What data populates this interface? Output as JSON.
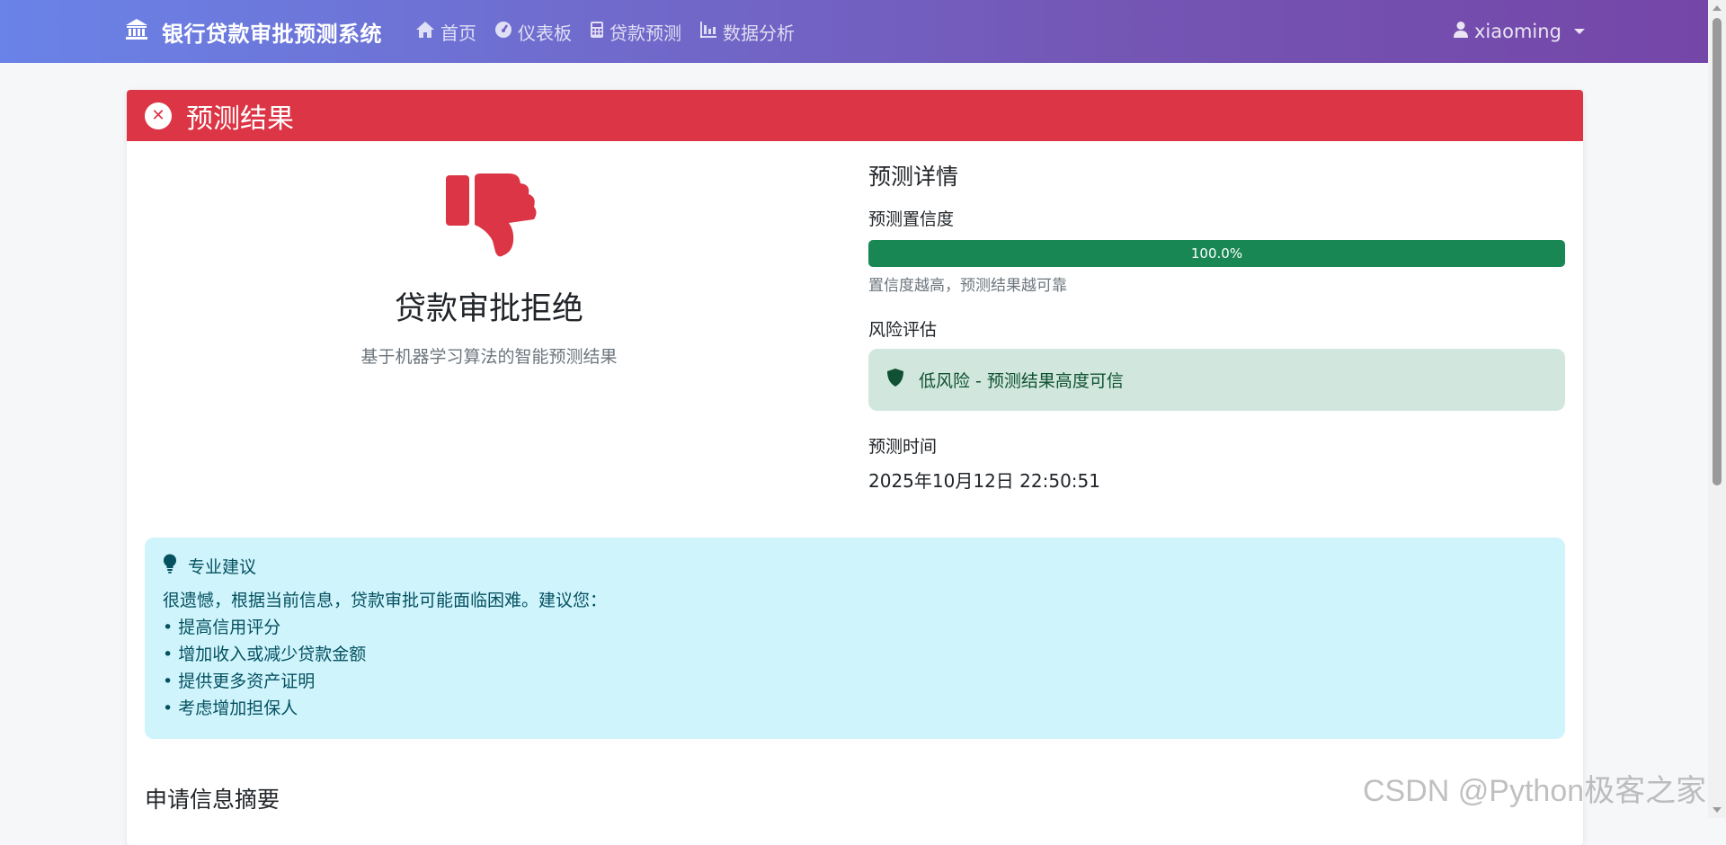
{
  "nav": {
    "brand": "银行贷款审批预测系统",
    "links": [
      "首页",
      "仪表板",
      "贷款预测",
      "数据分析"
    ],
    "user": "xiaoming"
  },
  "result": {
    "header_title": "预测结果",
    "decision": "贷款审批拒绝",
    "subtitle": "基于机器学习算法的智能预测结果"
  },
  "details": {
    "section_title": "预测详情",
    "confidence_label": "预测置信度",
    "confidence_value": "100.0%",
    "confidence_fraction": 1.0,
    "confidence_hint": "置信度越高，预测结果越可靠",
    "risk_label": "风险评估",
    "risk_text": "低风险 - 预测结果高度可信",
    "time_label": "预测时间",
    "time_value": "2025年10月12日 22:50:51"
  },
  "advice": {
    "title": "专业建议",
    "intro": "很遗憾，根据当前信息，贷款审批可能面临困难。建议您：",
    "items": [
      "• 提高信用评分",
      "• 增加收入或减少贷款金额",
      "• 提供更多资产证明",
      "• 考虑增加担保人"
    ]
  },
  "summary": {
    "title": "申请信息摘要"
  },
  "watermark": "CSDN @Python极客之家",
  "colors": {
    "header_red": "#dc3545",
    "success_green": "#198754",
    "risk_bg": "#d1e7dd",
    "advice_bg": "#cff4fc"
  },
  "icons": {
    "brand": "bank-icon",
    "nav": [
      "home-icon",
      "dashboard-icon",
      "calculator-icon",
      "chart-icon"
    ],
    "user": "user-icon",
    "result": "thumbs-down-icon",
    "risk": "shield-icon",
    "advice": "lightbulb-icon"
  }
}
